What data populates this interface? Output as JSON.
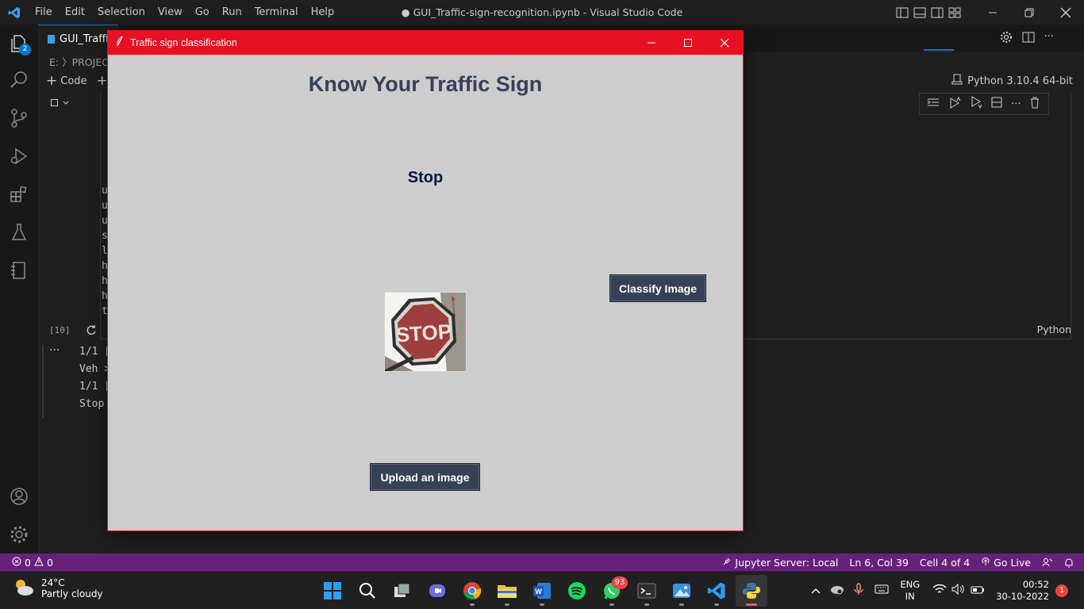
{
  "vscode": {
    "menu": [
      "File",
      "Edit",
      "Selection",
      "View",
      "Go",
      "Run",
      "Terminal",
      "Help"
    ],
    "window_title": "● GUI_Traffic-sign-recognition.ipynb - Visual Studio Code",
    "tab_label": "GUI_Traffi",
    "breadcrumb": "E: 〉PROJECT",
    "toolbar": {
      "code_label": "Code",
      "add_label": "+"
    },
    "kernel": "Python 3.10.4 64-bit",
    "explorer_badge": "2",
    "cell": {
      "code_lines": [
        "u",
        "u",
        "u",
        "s",
        "l",
        "h",
        "h",
        "h",
        "t"
      ],
      "execution_count": "[10]",
      "language": "Python"
    },
    "output_lines": [
      "1/1 [",
      "Veh >",
      "1/1 [",
      "Stop"
    ],
    "output_more": "···"
  },
  "dialog": {
    "title": "Traffic sign classification",
    "heading": "Know Your Traffic Sign",
    "result": "Stop",
    "classify_button": "Classify Image",
    "upload_button": "Upload an image",
    "sign_text": "STOP"
  },
  "statusbar": {
    "errors": "0",
    "warnings": "0",
    "jupyter": "Jupyter Server: Local",
    "position": "Ln 6, Col 39",
    "cell_index": "Cell 4 of 4",
    "go_live": "Go Live"
  },
  "taskbar": {
    "weather_temp": "24°C",
    "weather_desc": "Partly cloudy",
    "whatsapp_badge": "93",
    "lang_line1": "ENG",
    "lang_line2": "IN",
    "time": "00:52",
    "date": "30-10-2022",
    "notification_count": "1"
  },
  "colors": {
    "status_bar": "#68217a",
    "dialog_titlebar": "#e81123",
    "tk_button": "#364156",
    "heading": "#364156",
    "result": "#011638",
    "accent": "#0078d4"
  }
}
